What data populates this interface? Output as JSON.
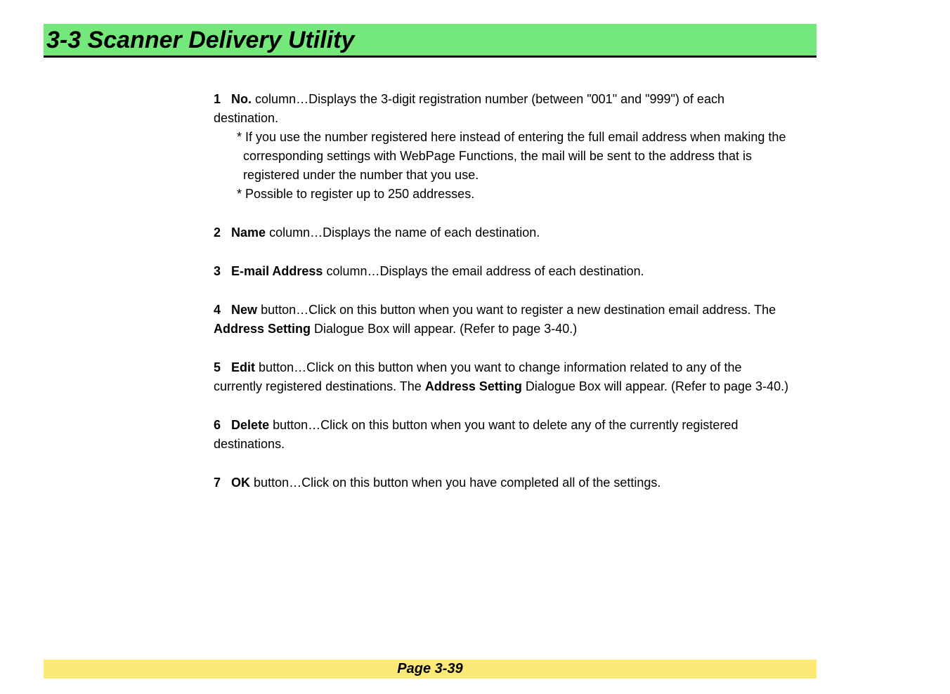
{
  "header": {
    "title": "3-3  Scanner Delivery Utility"
  },
  "items": [
    {
      "num": "1",
      "label": "No.",
      "text": " column…Displays the 3-digit registration number (between \"001\" and \"999\") of each destination.",
      "subnotes": [
        "* If you use the number registered here instead of entering the full email address when making the corresponding settings with WebPage Functions, the mail will be sent to the address that is registered under the number that you use.",
        "* Possible to register up to 250 addresses."
      ]
    },
    {
      "num": "2",
      "label": "Name",
      "text": " column…Displays the name of each destination."
    },
    {
      "num": "3",
      "label": "E-mail Address",
      "text": " column…Displays the email address of each destination."
    },
    {
      "num": "4",
      "label": "New",
      "text_before": " button…Click on this button when you want to register a new destination email address. The ",
      "bold2": "Address Setting",
      "text_after": " Dialogue Box will appear. (Refer to page 3-40.)"
    },
    {
      "num": "5",
      "label": "Edit",
      "text_before": " button…Click on this button when you want to change information related to any of the currently registered destinations. The ",
      "bold2": "Address Setting",
      "text_after": " Dialogue Box will appear. (Refer to page 3-40.)"
    },
    {
      "num": "6",
      "label": "Delete",
      "text": " button…Click on this button when you want to delete any of the currently registered destinations."
    },
    {
      "num": "7",
      "label": "OK",
      "text": " button…Click on this button when you have completed all of the settings."
    }
  ],
  "footer": {
    "page": "Page 3-39"
  }
}
